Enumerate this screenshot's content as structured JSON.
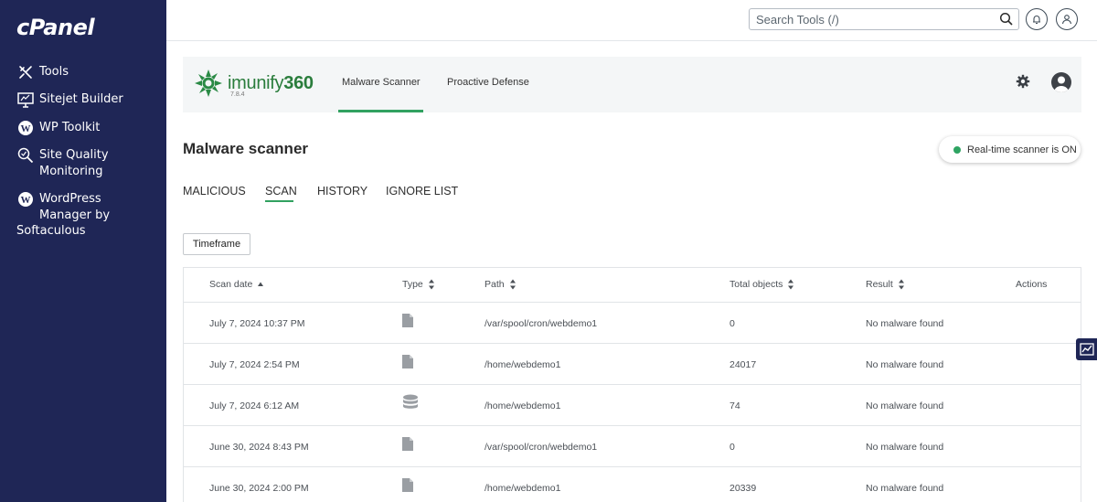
{
  "sidebar": {
    "logo": "cPanel",
    "items": [
      {
        "label": "Tools",
        "icon": "tools-icon"
      },
      {
        "label": "Sitejet Builder",
        "icon": "monitor-icon"
      },
      {
        "label": "WP Toolkit",
        "icon": "wordpress-icon"
      },
      {
        "label": "Site Quality Monitoring",
        "icon": "magnifier-icon"
      },
      {
        "label": "WordPress Manager by",
        "label_cont": "Softaculous",
        "icon": "wordpress-icon"
      }
    ]
  },
  "topbar": {
    "search_placeholder": "Search Tools (/)"
  },
  "imunify": {
    "brand": "imunify",
    "brand_num": "360",
    "version": "7.8.4",
    "tabs": [
      "Malware Scanner",
      "Proactive Defense"
    ],
    "active_tab": "Malware Scanner"
  },
  "page": {
    "title": "Malware scanner",
    "realtime_status": "Real-time scanner is ON",
    "realtime_color": "#2ea462"
  },
  "subtabs": [
    "MALICIOUS",
    "SCAN",
    "HISTORY",
    "IGNORE LIST"
  ],
  "active_subtab": "SCAN",
  "timeframe_label": "Timeframe",
  "table": {
    "headers": {
      "scan_date": "Scan date",
      "type": "Type",
      "path": "Path",
      "total": "Total objects",
      "result": "Result",
      "actions": "Actions"
    },
    "rows": [
      {
        "date": "July 7, 2024 10:37 PM",
        "type": "file-icon",
        "path": "/var/spool/cron/webdemo1",
        "total": "0",
        "result": "No malware found"
      },
      {
        "date": "July 7, 2024 2:54 PM",
        "type": "file-icon",
        "path": "/home/webdemo1",
        "total": "24017",
        "result": "No malware found"
      },
      {
        "date": "July 7, 2024 6:12 AM",
        "type": "database-icon",
        "path": "/home/webdemo1",
        "total": "74",
        "result": "No malware found"
      },
      {
        "date": "June 30, 2024 8:43 PM",
        "type": "file-icon",
        "path": "/var/spool/cron/webdemo1",
        "total": "0",
        "result": "No malware found"
      },
      {
        "date": "June 30, 2024 2:00 PM",
        "type": "file-icon",
        "path": "/home/webdemo1",
        "total": "20339",
        "result": "No malware found"
      }
    ]
  },
  "colors": {
    "sidebar_bg": "#1f2656",
    "accent_green": "#31a160"
  }
}
